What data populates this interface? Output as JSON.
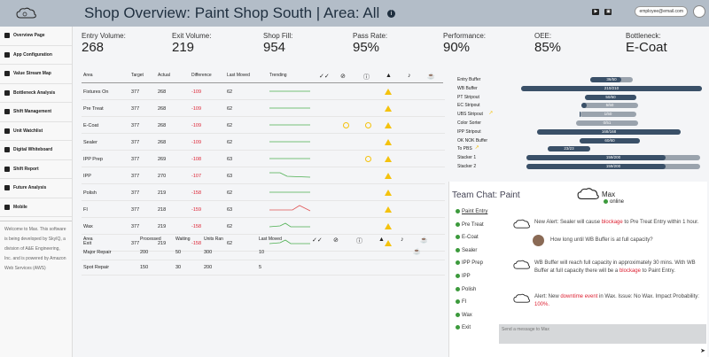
{
  "header": {
    "title": "Shop Overview: Paint Shop South | Area: All",
    "info_icon": "i",
    "email": "employee@email.com"
  },
  "sidebar": {
    "items": [
      {
        "label": "Overview Page",
        "icon": "home-icon"
      },
      {
        "label": "App Configuration",
        "icon": "wrench-icon"
      },
      {
        "label": "Value Stream Map",
        "icon": "map-icon"
      },
      {
        "label": "Bottleneck Analysis",
        "icon": "bottleneck-icon"
      },
      {
        "label": "Shift Management",
        "icon": "calendar-icon"
      },
      {
        "label": "Unit Watchlist",
        "icon": "eye-icon"
      },
      {
        "label": "Digital Whiteboard",
        "icon": "whiteboard-icon"
      },
      {
        "label": "Shift Report",
        "icon": "report-icon"
      },
      {
        "label": "Future Analysis",
        "icon": "chart-icon"
      },
      {
        "label": "Mobile",
        "icon": "mobile-icon"
      }
    ],
    "description": "Welcome to Max. This software is being developed by SkyIQ, a division of A&E Engineering, Inc. and is powered by Amazon Web Services (AWS)"
  },
  "metrics": [
    {
      "label": "Entry Volume:",
      "value": "268"
    },
    {
      "label": "Exit Volume:",
      "value": "219"
    },
    {
      "label": "Shop Fill:",
      "value": "954"
    },
    {
      "label": "Pass Rate:",
      "value": "95%"
    },
    {
      "label": "Performance:",
      "value": "90%"
    },
    {
      "label": "OEE:",
      "value": "85%"
    },
    {
      "label": "Bottleneck:",
      "value": "E-Coat"
    }
  ],
  "area_table": {
    "headers": [
      "Area",
      "Target",
      "Actual",
      "Difference",
      "Last Moved",
      "Trending"
    ],
    "rows": [
      {
        "area": "Fixtures On",
        "target": "377",
        "actual": "268",
        "diff": "-109",
        "moved": "62",
        "trend": "flat",
        "stop": false,
        "clock": false,
        "warn": true
      },
      {
        "area": "Pre Treat",
        "target": "377",
        "actual": "268",
        "diff": "-109",
        "moved": "62",
        "trend": "flat",
        "stop": false,
        "clock": false,
        "warn": true
      },
      {
        "area": "E-Coat",
        "target": "377",
        "actual": "268",
        "diff": "-109",
        "moved": "62",
        "trend": "flat",
        "stop": true,
        "clock": true,
        "warn": true
      },
      {
        "area": "Sealer",
        "target": "377",
        "actual": "268",
        "diff": "-109",
        "moved": "62",
        "trend": "flat",
        "stop": false,
        "clock": false,
        "warn": true
      },
      {
        "area": "IPP Prep",
        "target": "377",
        "actual": "269",
        "diff": "-108",
        "moved": "63",
        "trend": "flat",
        "stop": false,
        "clock": true,
        "warn": true
      },
      {
        "area": "IPP",
        "target": "377",
        "actual": "270",
        "diff": "-107",
        "moved": "63",
        "trend": "down",
        "stop": false,
        "clock": false,
        "warn": true
      },
      {
        "area": "Polish",
        "target": "377",
        "actual": "219",
        "diff": "-158",
        "moved": "62",
        "trend": "flat",
        "stop": false,
        "clock": false,
        "warn": true
      },
      {
        "area": "FI",
        "target": "377",
        "actual": "218",
        "diff": "-159",
        "moved": "63",
        "trend": "spike",
        "stop": false,
        "clock": false,
        "warn": true
      },
      {
        "area": "Wax",
        "target": "377",
        "actual": "219",
        "diff": "-158",
        "moved": "62",
        "trend": "bump",
        "stop": false,
        "clock": false,
        "warn": true
      },
      {
        "area": "Exit",
        "target": "377",
        "actual": "219",
        "diff": "-158",
        "moved": "62",
        "trend": "bump",
        "stop": false,
        "clock": false,
        "warn": true
      }
    ]
  },
  "repair_table": {
    "headers": [
      "Area",
      "Processed",
      "Waiting",
      "Units Ran",
      "Last Moved"
    ],
    "rows": [
      {
        "area": "Major Repair",
        "processed": "200",
        "waiting": "50",
        "ran": "300",
        "moved": "10",
        "flag": true
      },
      {
        "area": "Spot Repair",
        "processed": "150",
        "waiting": "30",
        "ran": "200",
        "moved": "5",
        "flag": false
      }
    ]
  },
  "buffers": [
    {
      "label": "Entry Buffer",
      "text": "36/50",
      "fraction": 0.72,
      "trend": false
    },
    {
      "label": "WB Buffer",
      "text": "210/210",
      "fraction": 1.0,
      "trend": false
    },
    {
      "label": "PT Stripout",
      "text": "50/50",
      "fraction": 1.0,
      "trend": false
    },
    {
      "label": "EC Stripout",
      "text": "5/50",
      "fraction": 0.1,
      "trend": false
    },
    {
      "label": "UBS Stripout",
      "text": "1/50",
      "fraction": 0.02,
      "trend": true
    },
    {
      "label": "Color Sorter",
      "text": "0/51",
      "fraction": 0.0,
      "trend": false
    },
    {
      "label": "IPP Stripout",
      "text": "168/168",
      "fraction": 1.0,
      "trend": false
    },
    {
      "label": "OK NOK Buffer",
      "text": "60/60",
      "fraction": 1.0,
      "trend": false
    },
    {
      "label": "To PBS",
      "text": "23/23",
      "fraction": 1.0,
      "trend": true
    },
    {
      "label": "Stacker 1",
      "text": "159/200",
      "fraction": 0.8,
      "trend": false
    },
    {
      "label": "Stacker 2",
      "text": "159/200",
      "fraction": 0.8,
      "trend": false
    }
  ],
  "chat": {
    "title": "Team Chat: Paint",
    "user": "Max",
    "status": "online",
    "channels": [
      "Paint Entry",
      "Pre Treat",
      "E-Coat",
      "Sealer",
      "IPP Prep",
      "IPP",
      "Polish",
      "FI",
      "Wax",
      "Exit"
    ],
    "messages": [
      {
        "parts": [
          "New Alert: Sealer will cause ",
          "blockage",
          " to Pre Treat Entry within 1 hour."
        ],
        "sender": "bot"
      },
      {
        "parts": [
          "How long until WB Buffer is at full capacity?"
        ],
        "sender": "user"
      },
      {
        "parts": [
          "WB Buffer will reach full capacity in approximately 30 mins. With WB Buffer at full capacity there will be a ",
          "blockage",
          " to Paint Entry."
        ],
        "sender": "bot"
      },
      {
        "parts": [
          "Alert: New ",
          "downtime event",
          " in Wax. Issue: No Wax. Impact Probability: ",
          "100%."
        ],
        "sender": "bot"
      }
    ],
    "input_placeholder": "Send a message to Max"
  },
  "colors": {
    "header_bg": "#b3bdc8",
    "bar_dark": "#3a5068",
    "bar_light": "#9aa3ad",
    "alert": "#d23",
    "warn": "#f4c20d",
    "online": "#3c9a3c"
  }
}
